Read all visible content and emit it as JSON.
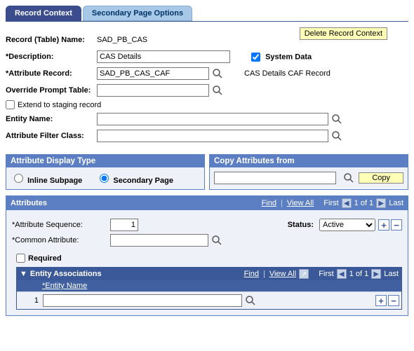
{
  "tabs": {
    "active": "Record Context",
    "inactive": "Secondary Page Options"
  },
  "buttons": {
    "delete": "Delete Record Context",
    "copy": "Copy"
  },
  "labels": {
    "recordName": "Record (Table) Name:",
    "description": "*Description:",
    "attrRecord": "*Attribute Record:",
    "overridePrompt": "Override Prompt Table:",
    "extendStaging": "Extend to staging record",
    "entityName": "Entity Name:",
    "attrFilter": "Attribute Filter Class:",
    "systemData": "System Data",
    "attrRecordFix": "CAS Details CAF Record"
  },
  "values": {
    "recordName": "SAD_PB_CAS",
    "description": "CAS Details",
    "attrRecord": "SAD_PB_CAS_CAF",
    "overridePrompt": "",
    "entityName": "",
    "attrFilter": "",
    "systemDataChecked": true
  },
  "panels": {
    "displayType": "Attribute Display Type",
    "copyFrom": "Copy Attributes from",
    "radio": {
      "inline": "Inline Subpage",
      "secondary": "Secondary Page"
    }
  },
  "attributes": {
    "header": "Attributes",
    "find": "Find",
    "viewAll": "View All",
    "first": "First",
    "last": "Last",
    "position": "1 of 1",
    "seqLabel": "*Attribute Sequence:",
    "seqVal": "1",
    "statusLabel": "Status:",
    "statusVal": "Active",
    "commonLabel": "*Common Attribute:",
    "commonVal": "",
    "requiredLabel": "Required"
  },
  "entity": {
    "header": "Entity Associations",
    "find": "Find",
    "viewAll": "View All",
    "first": "First",
    "last": "Last",
    "position": "1 of 1",
    "colName": "*Entity Name",
    "rowNum": "1",
    "rowVal": ""
  }
}
